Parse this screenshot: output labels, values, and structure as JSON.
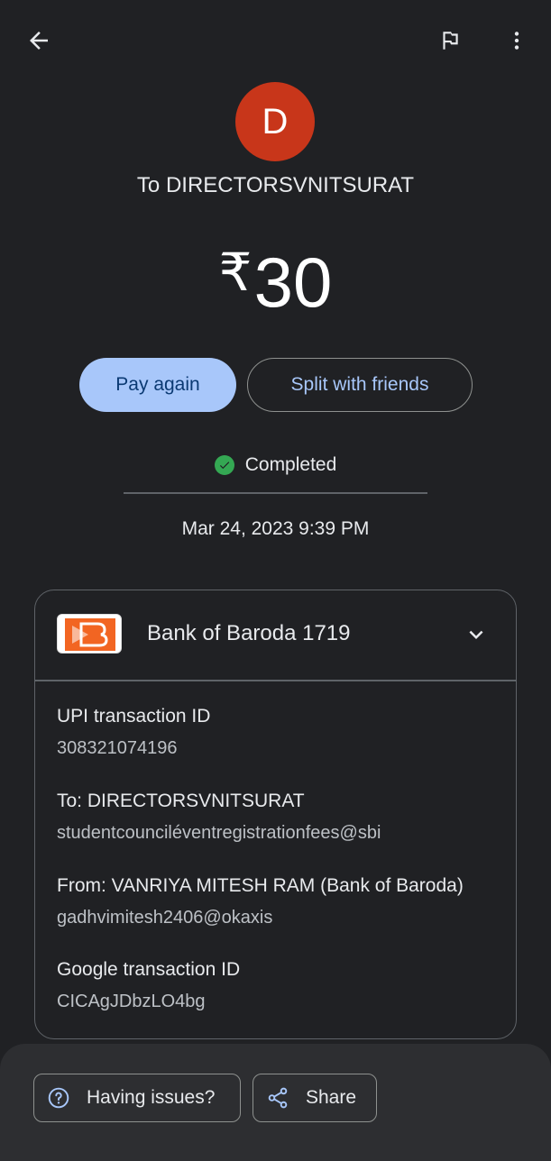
{
  "header": {
    "back_icon": "arrow-back-icon",
    "flag_icon": "flag-icon",
    "more_icon": "more-vert-icon"
  },
  "recipient": {
    "avatar_letter": "D",
    "avatar_color": "#c8361a",
    "title": "To DIRECTORSVNITSURAT"
  },
  "amount": {
    "currency": "₹",
    "value": "30"
  },
  "actions": {
    "pay_again": "Pay again",
    "split": "Split with friends"
  },
  "status": {
    "text": "Completed",
    "color": "#34a853"
  },
  "timestamp": "Mar 24, 2023 9:39 PM",
  "payment_method": {
    "bank_name": "Bank of Baroda 1719",
    "logo_icon": "bank-of-baroda-logo"
  },
  "details": [
    {
      "label": "UPI transaction ID",
      "value": "308321074196"
    },
    {
      "label": "To: DIRECTORSVNITSURAT",
      "value": "studentcounciléventregistrationfees@sbi"
    },
    {
      "label": "From: VANRIYA MITESH RAM (Bank of Baroda)",
      "value": "gadhvimitesh2406@okaxis"
    },
    {
      "label": "Google transaction ID",
      "value": "CICAgJDbzLO4bg"
    }
  ],
  "footer": {
    "issues": "Having issues?",
    "share": "Share"
  },
  "colors": {
    "background": "#202124",
    "accent": "#a8c7fa"
  }
}
